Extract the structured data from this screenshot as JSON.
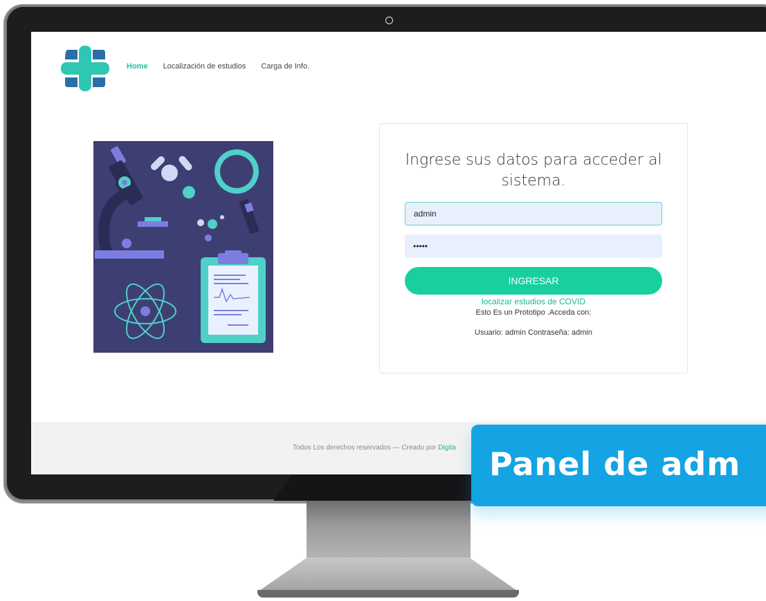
{
  "nav": {
    "items": [
      {
        "label": "Home",
        "active": true
      },
      {
        "label": "Localización de estudios",
        "active": false
      },
      {
        "label": "Carga de Info.",
        "active": false
      }
    ]
  },
  "login": {
    "title": "Ingrese sus datos para acceder al sistema.",
    "username_value": "admin",
    "password_value": "•••••",
    "submit_label": "INGRESAR",
    "link_label": "localizar estudios de COVID",
    "note_line1": "Esto Es un Prototipo .Acceda con:",
    "note_line2": "Usuario: admin Contraseña: admin"
  },
  "footer": {
    "text": "Todos Los derechos reservados — Creado por ",
    "link": "Digita"
  },
  "banner": {
    "text": "Panel de adm"
  },
  "colors": {
    "accent": "#19cfa0",
    "banner": "#14a4e4",
    "illustration_bg": "#3d3f72"
  }
}
